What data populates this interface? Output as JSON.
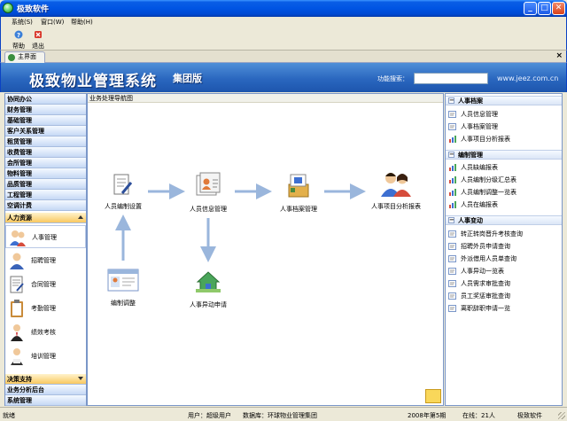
{
  "window": {
    "title": "极致软件"
  },
  "menu": [
    {
      "label": "系统(S)"
    },
    {
      "label": "窗口(W)"
    },
    {
      "label": "帮助(H)"
    }
  ],
  "toolbar": {
    "help_label": "帮助",
    "exit_label": "退出"
  },
  "tab": {
    "label": "主界面"
  },
  "banner": {
    "title": "极致物业管理系统",
    "edition": "集团版",
    "search_label": "功能搜索：",
    "search_value": "",
    "url": "www.jeez.com.cn"
  },
  "nav": {
    "categories": [
      {
        "label": "协同办公"
      },
      {
        "label": "财务管理"
      },
      {
        "label": "基础管理"
      },
      {
        "label": "客户关系管理"
      },
      {
        "label": "租赁管理"
      },
      {
        "label": "收费管理"
      },
      {
        "label": "会所管理"
      },
      {
        "label": "物料管理"
      },
      {
        "label": "品质管理"
      },
      {
        "label": "工程管理"
      },
      {
        "label": "空调计费"
      }
    ],
    "active_category": "人力资源",
    "sub_items": [
      {
        "label": "人事管理",
        "icon": "people-icon"
      },
      {
        "label": "招聘管理",
        "icon": "recruit-icon"
      },
      {
        "label": "合同管理",
        "icon": "contract-icon"
      },
      {
        "label": "考勤管理",
        "icon": "clipboard-icon"
      },
      {
        "label": "绩效考核",
        "icon": "person-icon"
      },
      {
        "label": "培训管理",
        "icon": "training-icon"
      }
    ],
    "bottom_categories": [
      {
        "label": "决策支持"
      },
      {
        "label": "业务分析后台"
      },
      {
        "label": "系统管理"
      }
    ]
  },
  "center": {
    "title": "业务处理导航图",
    "flow": {
      "staff_setup": "人员编制设置",
      "staff_info": "人员信息管理",
      "personnel_archive": "人事档案管理",
      "analysis_report": "人事项目分析报表",
      "staff_adjust": "编制调整",
      "personnel_change": "人事异动申请"
    }
  },
  "right": {
    "sections": [
      {
        "title": "人事档案",
        "items": [
          "人员信息管理",
          "人事档案管理",
          "人事项目分析报表"
        ]
      },
      {
        "title": "编制管理",
        "items": [
          "人员缺编报表",
          "人员编制分级汇总表",
          "人员编制调整一览表",
          "人员在编报表"
        ]
      },
      {
        "title": "人事变动",
        "items": [
          "转正转岗晋升考核查询",
          "招聘外员申请查询",
          "外派借用人员单查询",
          "人事异动一览表",
          "人员需求审批查询",
          "员工奖惩审批查询",
          "离职辞职申请一览"
        ]
      }
    ]
  },
  "status": {
    "ready": "就绪",
    "user": "用户：超级用户",
    "database": "数据库：环球物业管理集团",
    "period": "2008年第5期",
    "online": "在线：21人",
    "vendor": "极致软件"
  },
  "colors": {
    "titlebar": "#0054e3",
    "banner": "#2a67bf",
    "active_nav": "#f9c860"
  }
}
